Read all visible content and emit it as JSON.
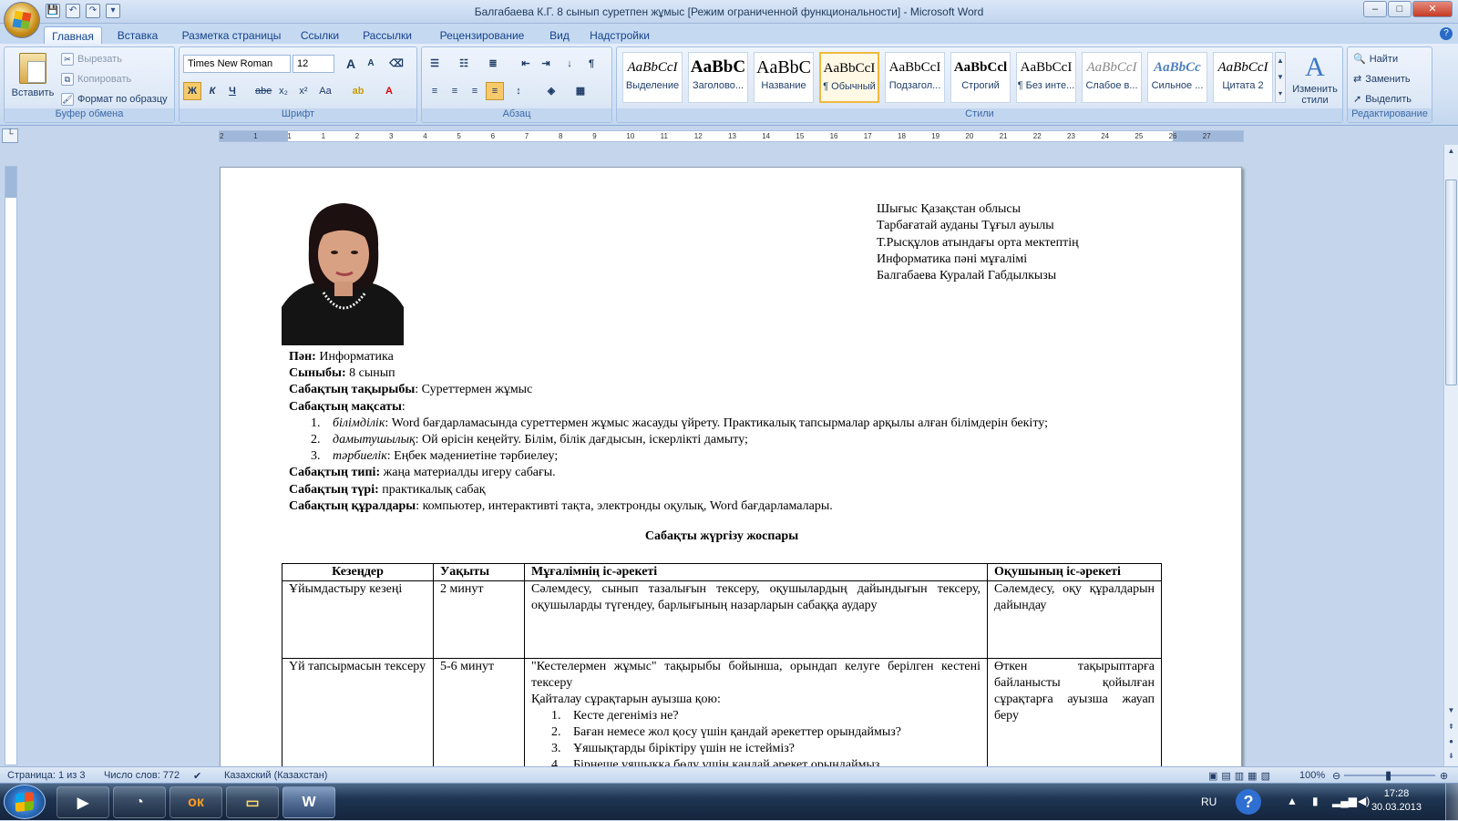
{
  "window": {
    "title": "Балгабаева К.Г. 8 сынып суретпен жұмыс [Режим ограниченной функциональности] - Microsoft Word",
    "controls": [
      "–",
      "□",
      "✕"
    ]
  },
  "tabs": [
    "Главная",
    "Вставка",
    "Разметка страницы",
    "Ссылки",
    "Рассылки",
    "Рецензирование",
    "Вид",
    "Надстройки"
  ],
  "ribbon": {
    "clipboard": {
      "paste": "Вставить",
      "cut": "Вырезать",
      "copy": "Копировать",
      "format_painter": "Формат по образцу",
      "label": "Буфер обмена"
    },
    "font": {
      "name": "Times New Roman",
      "size": "12",
      "label": "Шрифт",
      "bold": "Ж",
      "italic": "К",
      "underline": "Ч",
      "strike": "abe",
      "subscript": "x₂",
      "superscript": "x²",
      "case": "Aa",
      "grow": "A",
      "shrink": "A"
    },
    "paragraph": {
      "label": "Абзац"
    },
    "styles": {
      "label": "Стили",
      "items": [
        {
          "preview": "AaBbCcI",
          "name": "Выделение"
        },
        {
          "preview": "AaBbC",
          "name": "Заголово..."
        },
        {
          "preview": "AaBbC",
          "name": "Название"
        },
        {
          "preview": "AaBbCcI",
          "name": "¶ Обычный"
        },
        {
          "preview": "AaBbCcI",
          "name": "Подзагол..."
        },
        {
          "preview": "AaBbCcl",
          "name": "Строгий"
        },
        {
          "preview": "AaBbCcI",
          "name": "¶ Без инте..."
        },
        {
          "preview": "AaBbCcI",
          "name": "Слабое в..."
        },
        {
          "preview": "AaBbCc",
          "name": "Сильное ..."
        },
        {
          "preview": "AaBbCcI",
          "name": "Цитата 2"
        }
      ],
      "change": "Изменить стили"
    },
    "editing": {
      "label": "Редактирование",
      "find": "Найти",
      "replace": "Заменить",
      "select": "Выделить"
    }
  },
  "ruler_ticks": [
    "2",
    "1",
    "1",
    "1",
    "2",
    "3",
    "4",
    "5",
    "6",
    "7",
    "8",
    "9",
    "10",
    "11",
    "12",
    "13",
    "14",
    "15",
    "16",
    "17",
    "18",
    "19",
    "20",
    "21",
    "22",
    "23",
    "24",
    "25",
    "26",
    "27"
  ],
  "document": {
    "address": [
      "Шығыс Қазақстан облысы",
      "Тарбағатай ауданы Тұғыл ауылы",
      "Т.Рысқұлов атындағы орта мектептің",
      "Информатика пәні мұғалімі",
      "Балгабаева Куралай Габдылкызы"
    ],
    "subject": {
      "label": "Пән:",
      "value": " Информатика"
    },
    "grade": {
      "label": "Сыныбы:",
      "value": " 8 сынып"
    },
    "topic": {
      "label": "Сабақтың тақырыбы",
      "value": ": Суреттермен жұмыс"
    },
    "goals": {
      "label": "Сабақтың мақсаты",
      "value": ":"
    },
    "goal_items": [
      {
        "num": "1.",
        "name": "білімділік",
        "text": ": Word бағдарламасында суреттермен жұмыс жасауды үйрету. Практикалық тапсырмалар арқылы алған білімдерін бекіту;"
      },
      {
        "num": "2.",
        "name": "дамытушылық",
        "text": ": Ой өрісін кеңейту. Білім, білік дағдысын, іскерлікті  дамыту;"
      },
      {
        "num": "3.",
        "name": "тәрбиелік",
        "text": ": Еңбек мәдениетіне тәрбиелеу;"
      }
    ],
    "type": {
      "label": "Сабақтың типі:",
      "value": " жаңа материалды игеру сабағы."
    },
    "kind": {
      "label": "Сабақтың түрі:",
      "value": " практикалық сабақ"
    },
    "tools": {
      "label": "Сабақтың құралдары",
      "value": ": компьютер, интерактивті тақта, электронды оқулық, Word  бағдарламалары."
    },
    "plan_title": "Сабақты жүргізу жоспары",
    "table": {
      "headers": [
        "Кезеңдер",
        "Уақыты",
        "Мұғалімнің іс-әрекеті",
        "Оқушының іс-әрекеті"
      ],
      "row1": {
        "stage": "Ұйымдастыру кезеңі",
        "time": "2 минут",
        "teacher": "Сәлемдесу, сынып тазалығын тексеру, оқушылардың дайындығын тексеру, оқушыларды түгендеу, барлығының назарларын сабаққа аудару",
        "student": "Сәлемдесу, оқу құралдарын дайындау"
      },
      "row2": {
        "stage": "Үй тапсырмасын тексеру",
        "time": "5-6 минут",
        "teacher": "\"Кестелермен жұмыс\" тақырыбы бойынша, орындап келуге берілген кестені тексеру",
        "teacher_q": "Қайталау сұрақтарын ауызша қою:",
        "questions": [
          {
            "num": "1.",
            "text": "Кесте дегеніміз не?"
          },
          {
            "num": "2.",
            "text": "Баған немесе жол қосу үшін қандай әрекеттер орындаймыз?"
          },
          {
            "num": "3.",
            "text": "Ұяшықтарды біріктіру үшін не істейміз?"
          },
          {
            "num": "4.",
            "text": "Бірнеше ұяшыққа бөлу үшін қандай әрекет орындаймыз"
          }
        ],
        "student": "Өткен тақырыптарға байланысты қойылған сұрақтарға ауызша жауап беру"
      }
    }
  },
  "status": {
    "page": "Страница: 1 из 3",
    "words": "Число слов: 772",
    "language": "Казахский (Казахстан)",
    "zoom": "100%"
  },
  "taskbar": {
    "lang": "RU",
    "time": "17:28",
    "date": "30.03.2013"
  }
}
